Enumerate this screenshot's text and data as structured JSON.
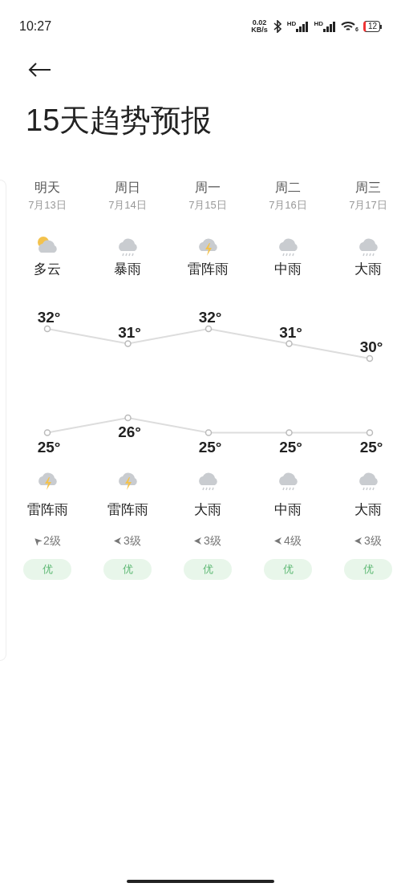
{
  "status_bar": {
    "time": "10:27",
    "speed_value": "0.02",
    "speed_unit": "KB/s",
    "signal_labels": [
      "HD",
      "HD"
    ],
    "wifi_label": "6",
    "battery": "12"
  },
  "title": "15天趋势预报",
  "days": [
    {
      "day": "明天",
      "date": "7月13日",
      "day_weather": {
        "kind": "cloudy",
        "label": "多云"
      },
      "night_weather": {
        "kind": "thunder",
        "label": "雷阵雨"
      },
      "wind": {
        "kind": "northwest",
        "label": "2级"
      },
      "aqi": "优"
    },
    {
      "day": "周日",
      "date": "7月14日",
      "day_weather": {
        "kind": "rain",
        "label": "暴雨"
      },
      "night_weather": {
        "kind": "thunder",
        "label": "雷阵雨"
      },
      "wind": {
        "kind": "west",
        "label": "3级"
      },
      "aqi": "优"
    },
    {
      "day": "周一",
      "date": "7月15日",
      "day_weather": {
        "kind": "thunder",
        "label": "雷阵雨"
      },
      "night_weather": {
        "kind": "rain",
        "label": "大雨"
      },
      "wind": {
        "kind": "west",
        "label": "3级"
      },
      "aqi": "优"
    },
    {
      "day": "周二",
      "date": "7月16日",
      "day_weather": {
        "kind": "rain",
        "label": "中雨"
      },
      "night_weather": {
        "kind": "rain",
        "label": "中雨"
      },
      "wind": {
        "kind": "west",
        "label": "4级"
      },
      "aqi": "优"
    },
    {
      "day": "周三",
      "date": "7月17日",
      "day_weather": {
        "kind": "rain",
        "label": "大雨"
      },
      "night_weather": {
        "kind": "rain",
        "label": "大雨"
      },
      "wind": {
        "kind": "west",
        "label": "3级"
      },
      "aqi": "优"
    }
  ],
  "chart_data": {
    "type": "line",
    "series": [
      {
        "color": "#dddddd",
        "marker": "circle",
        "values": [
          32,
          31,
          32,
          31,
          30
        ],
        "value_labels": [
          "32°",
          "31°",
          "32°",
          "31°",
          "30°"
        ]
      },
      {
        "color": "#dddddd",
        "marker": "circle",
        "values": [
          25,
          26,
          25,
          25,
          25
        ],
        "value_labels": [
          "25°",
          "26°",
          "25°",
          "25°",
          "25°"
        ]
      }
    ]
  }
}
